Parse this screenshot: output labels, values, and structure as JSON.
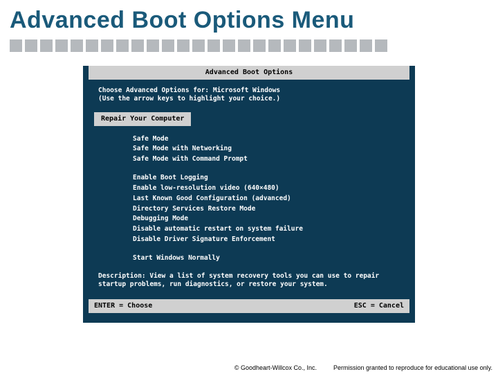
{
  "slide": {
    "title": "Advanced Boot Options Menu"
  },
  "boot": {
    "header": "Advanced Boot Options",
    "instr_line1": "Choose Advanced Options for: Microsoft Windows",
    "instr_line2": "(Use the arrow keys to highlight your choice.)",
    "selected": "Repair Your Computer",
    "group1": [
      "Safe Mode",
      "Safe Mode with Networking",
      "Safe Mode with Command Prompt"
    ],
    "group2": [
      "Enable Boot Logging",
      "Enable low-resolution video (640×480)",
      "Last Known Good Configuration (advanced)",
      "Directory Services Restore Mode",
      "Debugging Mode",
      "Disable automatic restart on system failure",
      "Disable Driver Signature Enforcement"
    ],
    "group3": [
      "Start Windows Normally"
    ],
    "description": "Description: View a list of system recovery tools you can use to repair startup problems, run diagnostics, or restore your system.",
    "footer_left": "ENTER = Choose",
    "footer_right": "ESC = Cancel"
  },
  "footer": {
    "copyright": "© Goodheart-Willcox Co., Inc.",
    "permission": "Permission granted to reproduce for educational use only."
  }
}
